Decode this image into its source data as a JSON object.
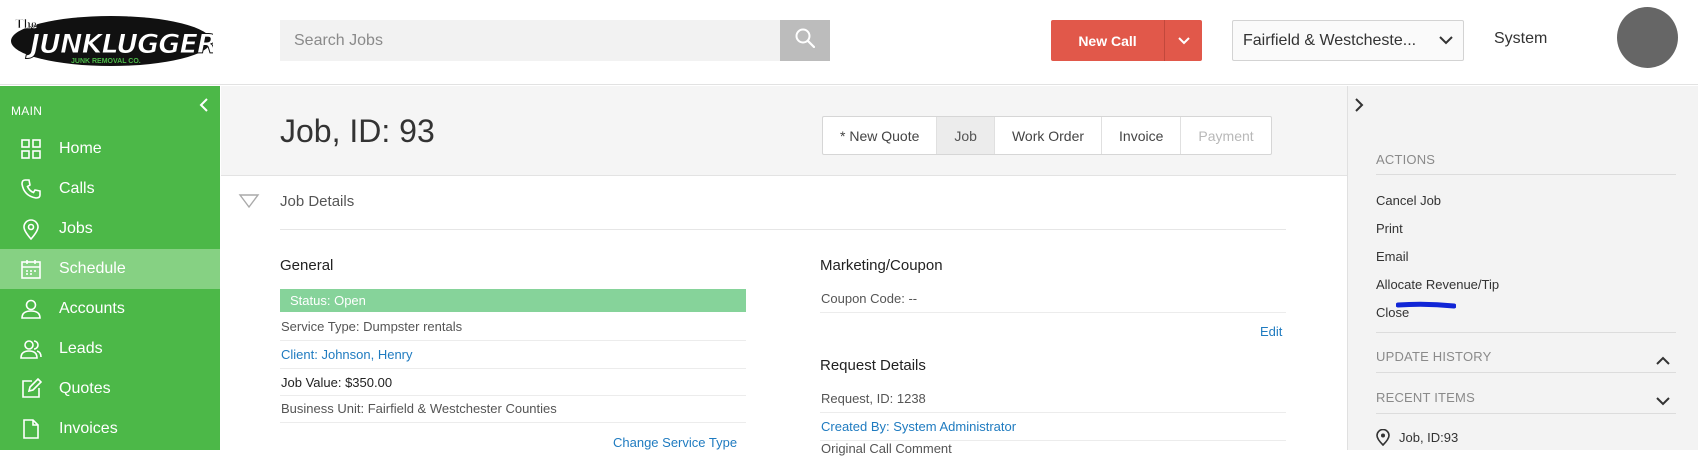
{
  "header": {
    "logo_alt": "The Junkluggers",
    "logo_tagline": "Junk Removal Co.",
    "search_placeholder": "Search Jobs",
    "new_call_label": "New Call",
    "business_unit": "Fairfield & Westcheste...",
    "user_name": "System"
  },
  "sidebar": {
    "section_label": "MAIN",
    "items": [
      {
        "label": "Home",
        "icon": "grid-icon"
      },
      {
        "label": "Calls",
        "icon": "phone-icon"
      },
      {
        "label": "Jobs",
        "icon": "map-pin-icon"
      },
      {
        "label": "Schedule",
        "icon": "calendar-icon",
        "active": true
      },
      {
        "label": "Accounts",
        "icon": "user-icon"
      },
      {
        "label": "Leads",
        "icon": "users-icon"
      },
      {
        "label": "Quotes",
        "icon": "edit-icon"
      },
      {
        "label": "Invoices",
        "icon": "document-icon"
      }
    ]
  },
  "page": {
    "title": "Job, ID: 93",
    "tabs": [
      {
        "label": "* New Quote",
        "state": "normal"
      },
      {
        "label": "Job",
        "state": "active"
      },
      {
        "label": "Work Order",
        "state": "normal"
      },
      {
        "label": "Invoice",
        "state": "normal"
      },
      {
        "label": "Payment",
        "state": "disabled"
      }
    ],
    "section_title": "Job Details"
  },
  "general": {
    "heading": "General",
    "status": "Status: Open",
    "service_type": "Service Type: Dumpster rentals",
    "client": "Client: Johnson, Henry",
    "job_value": "Job Value: $350.00",
    "business_unit": "Business Unit: Fairfield & Westchester Counties",
    "change_service_type": "Change Service Type"
  },
  "marketing": {
    "heading": "Marketing/Coupon",
    "coupon": "Coupon Code: --",
    "edit_label": "Edit"
  },
  "request": {
    "heading": "Request Details",
    "request_id": "Request, ID: 1238",
    "created_by": "Created By: System Administrator",
    "partial_text": "Original Call Comment"
  },
  "right_panel": {
    "actions_heading": "ACTIONS",
    "actions": [
      "Cancel Job",
      "Print",
      "Email",
      "Allocate Revenue/Tip",
      "Close"
    ],
    "update_history": "UPDATE HISTORY",
    "recent_items": "RECENT ITEMS",
    "recent": [
      {
        "label": "Job, ID:93"
      }
    ]
  },
  "colors": {
    "brand_green": "#4cb848",
    "active_nav": "#86d183",
    "new_call_red": "#e1584a",
    "status_green": "#86d39a",
    "link_blue": "#1f7bc0",
    "annotation_blue": "#1025d6"
  }
}
